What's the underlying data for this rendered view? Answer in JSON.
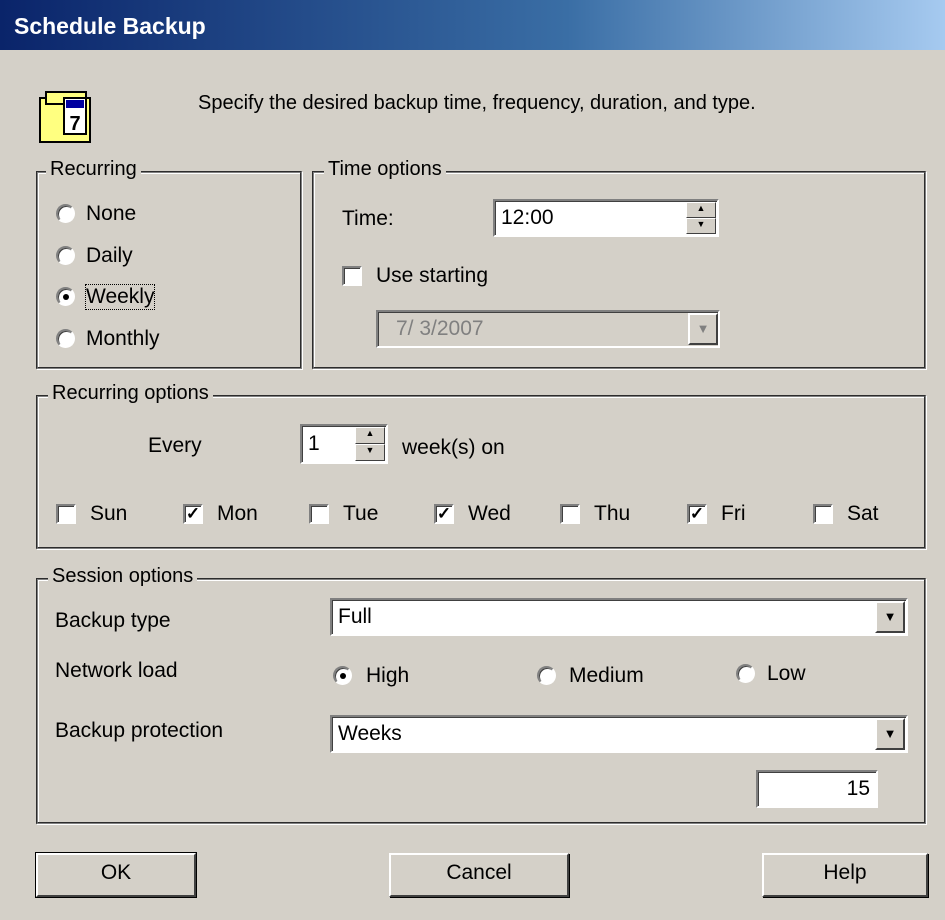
{
  "window": {
    "title": "Schedule Backup"
  },
  "intro": "Specify the desired backup time, frequency, duration, and type.",
  "recurring": {
    "legend": "Recurring",
    "options": [
      {
        "label": "None",
        "selected": false
      },
      {
        "label": "Daily",
        "selected": false
      },
      {
        "label": "Weekly",
        "selected": true
      },
      {
        "label": "Monthly",
        "selected": false
      }
    ]
  },
  "time_options": {
    "legend": "Time options",
    "time_label": "Time:",
    "time_value": "12:00",
    "use_starting_label": "Use starting",
    "use_starting_checked": false,
    "start_date": "7/ 3/2007"
  },
  "recurring_options": {
    "legend": "Recurring options",
    "every_label": "Every",
    "every_value": "1",
    "unit_label": "week(s) on",
    "days": [
      {
        "label": "Sun",
        "checked": false
      },
      {
        "label": "Mon",
        "checked": true
      },
      {
        "label": "Tue",
        "checked": false
      },
      {
        "label": "Wed",
        "checked": true
      },
      {
        "label": "Thu",
        "checked": false
      },
      {
        "label": "Fri",
        "checked": true
      },
      {
        "label": "Sat",
        "checked": false
      }
    ]
  },
  "session_options": {
    "legend": "Session options",
    "backup_type_label": "Backup type",
    "backup_type_value": "Full",
    "network_load_label": "Network load",
    "network_load": [
      {
        "label": "High",
        "selected": true
      },
      {
        "label": "Medium",
        "selected": false
      },
      {
        "label": "Low",
        "selected": false
      }
    ],
    "backup_protection_label": "Backup protection",
    "backup_protection_value": "Weeks",
    "protection_count": "15"
  },
  "buttons": {
    "ok": "OK",
    "cancel": "Cancel",
    "help": "Help"
  },
  "colors": {
    "title_start": "#0a246a",
    "title_end": "#a6caf0",
    "dialog_bg": "#d4d0c8"
  }
}
